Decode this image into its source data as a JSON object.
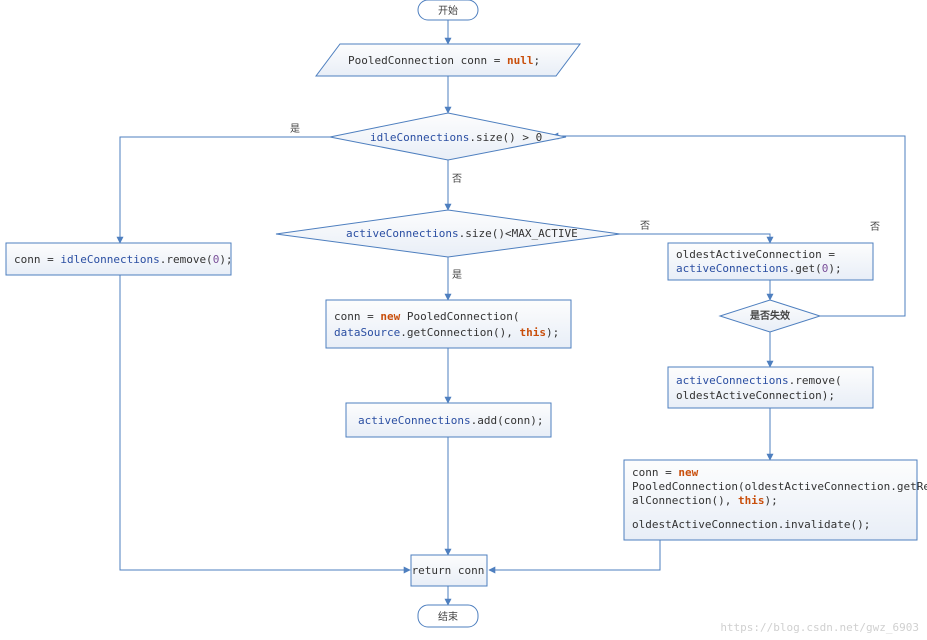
{
  "flowchart": {
    "start_label": "开始",
    "end_label": "结束",
    "watermark": "https://blog.csdn.net/gwz_6903",
    "edge_labels": {
      "yes": "是",
      "no": "否",
      "is_invalid": "是否失效"
    },
    "nodes": {
      "init": {
        "tokens": [
          {
            "t": "PooledConnection conn = ",
            "cls": "code"
          },
          {
            "t": "null",
            "cls": "code-k"
          },
          {
            "t": ";",
            "cls": "code"
          }
        ]
      },
      "cond_idle": {
        "tokens": [
          {
            "t": "idleConnections",
            "cls": "code-fn"
          },
          {
            "t": ".size() > 0",
            "cls": "code"
          }
        ]
      },
      "cond_active": {
        "tokens": [
          {
            "t": "activeConnections",
            "cls": "code-fn"
          },
          {
            "t": ".size()<MAX_ACTIVE",
            "cls": "code"
          }
        ]
      },
      "idle_remove": {
        "tokens": [
          {
            "t": "conn = ",
            "cls": "code"
          },
          {
            "t": "idleConnections",
            "cls": "code-fn"
          },
          {
            "t": ".remove(",
            "cls": "code"
          },
          {
            "t": "0",
            "cls": "code-ty"
          },
          {
            "t": ");",
            "cls": "code"
          }
        ]
      },
      "oldest_get": {
        "line1": [
          {
            "t": "oldestActiveConnection = ",
            "cls": "code"
          }
        ],
        "line2": [
          {
            "t": "activeConnections",
            "cls": "code-fn"
          },
          {
            "t": ".get(",
            "cls": "code"
          },
          {
            "t": "0",
            "cls": "code-ty"
          },
          {
            "t": ");",
            "cls": "code"
          }
        ]
      },
      "new_conn": {
        "line1": [
          {
            "t": "conn = ",
            "cls": "code"
          },
          {
            "t": "new",
            "cls": "code-k"
          },
          {
            "t": " PooledConnection(",
            "cls": "code"
          }
        ],
        "line2": [
          {
            "t": "dataSource",
            "cls": "code-fn"
          },
          {
            "t": ".getConnection(), ",
            "cls": "code"
          },
          {
            "t": "this",
            "cls": "code-k"
          },
          {
            "t": ");",
            "cls": "code"
          }
        ]
      },
      "active_remove": {
        "line1": [
          {
            "t": "activeConnections",
            "cls": "code-fn"
          },
          {
            "t": ".remove(",
            "cls": "code"
          }
        ],
        "line2": [
          {
            "t": "oldestActiveConnection);",
            "cls": "code"
          }
        ]
      },
      "active_add": {
        "tokens": [
          {
            "t": "activeConnections",
            "cls": "code-fn"
          },
          {
            "t": ".add(conn);",
            "cls": "code"
          }
        ]
      },
      "reuse_oldest": {
        "line1": [
          {
            "t": "conn = ",
            "cls": "code"
          },
          {
            "t": "new",
            "cls": "code-k"
          }
        ],
        "line2": [
          {
            "t": "PooledConnection(oldestActiveConnection.getRe",
            "cls": "code"
          }
        ],
        "line3": [
          {
            "t": "alConnection(), ",
            "cls": "code"
          },
          {
            "t": "this",
            "cls": "code-k"
          },
          {
            "t": ");",
            "cls": "code"
          }
        ],
        "line4": [
          {
            "t": "oldestActiveConnection.invalidate();",
            "cls": "code"
          }
        ]
      },
      "ret": {
        "tokens": [
          {
            "t": "return conn",
            "cls": "code"
          }
        ]
      }
    }
  }
}
